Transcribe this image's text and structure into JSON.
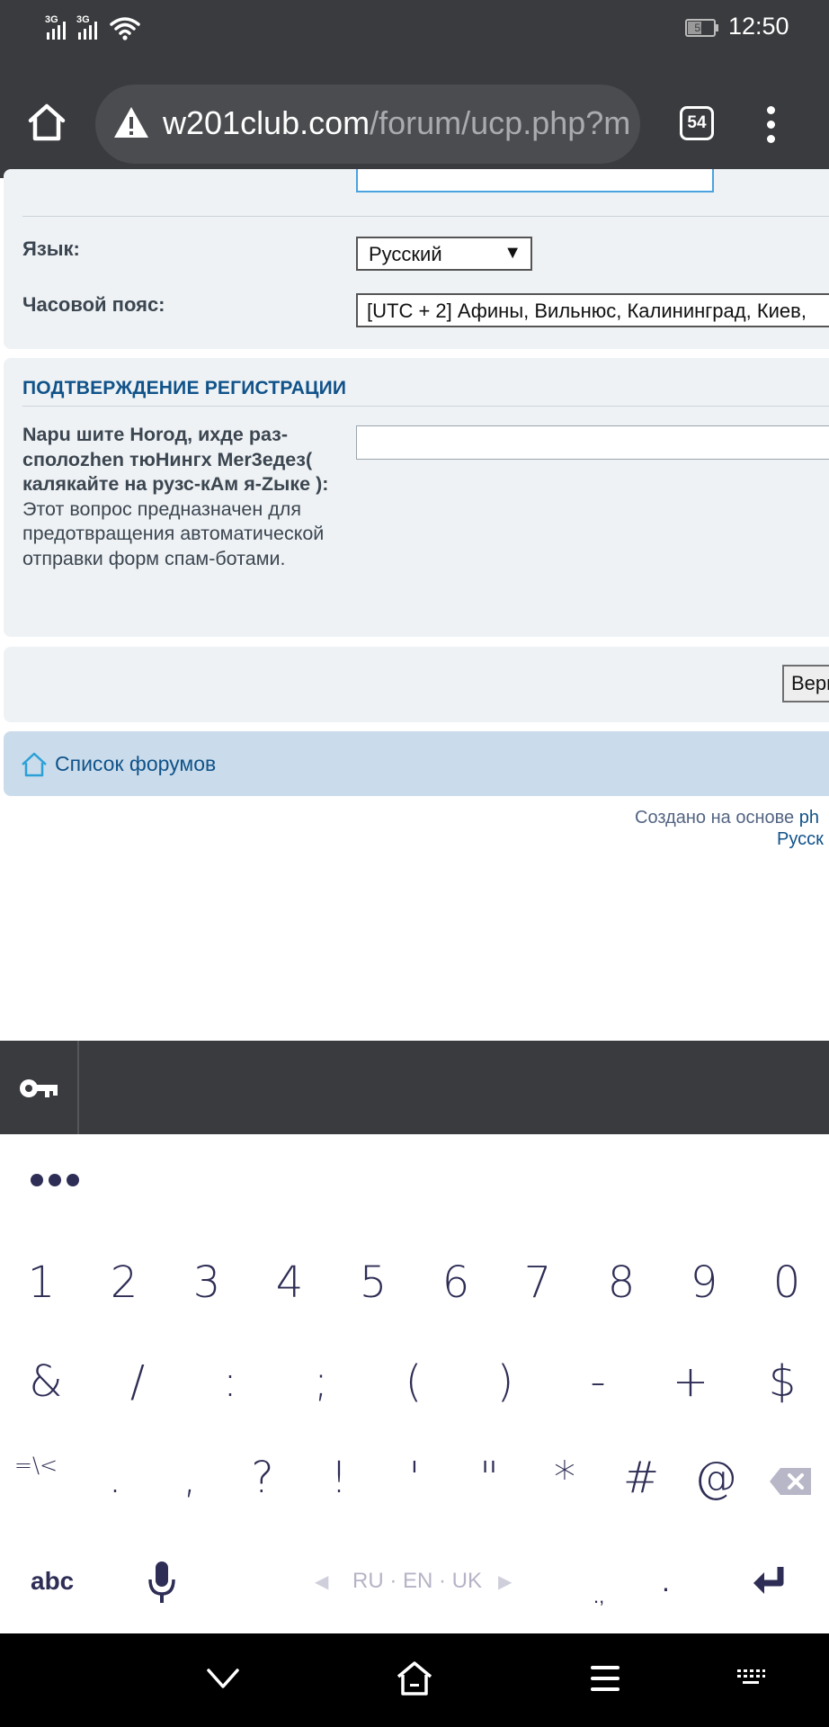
{
  "status_bar": {
    "signal1_label": "3G",
    "signal2_label": "3G",
    "battery": "55",
    "battery_level": 0.55,
    "time": "12:50"
  },
  "browser": {
    "url_domain": "w201club.com",
    "url_path": "/forum/ucp.php?m",
    "tab_count": "54"
  },
  "form": {
    "language_label": "Язык:",
    "language_value": "Русский",
    "timezone_label": "Часовой пояс:",
    "timezone_value": "[UTC + 2] Афины, Вильнюс, Калининград, Киев,"
  },
  "registration": {
    "title": "ПОДТВЕРЖДЕНИЕ РЕГИСТРАЦИИ",
    "question": "Napu шите Horoд, ихде раз-сполоzhen тюНингх Mer3eдез( калякайте на рузс-кАм я-Zыке ):",
    "explain": "Этот вопрос предназначен для предотвращения автоматической отправки форм спам-ботами.",
    "answer_value": ""
  },
  "submit": {
    "label": "Вери"
  },
  "nav": {
    "forum_list": "Список форумов"
  },
  "footer": {
    "created_prefix": "Создано на основе",
    "created_link": "ph",
    "lang_link": "Русск"
  },
  "keyboard": {
    "row_numbers": [
      "1",
      "2",
      "3",
      "4",
      "5",
      "6",
      "7",
      "8",
      "9",
      "0"
    ],
    "row_symbols1": [
      "&",
      "/",
      ":",
      ";",
      "(",
      ")",
      "-",
      "+",
      "$"
    ],
    "row_symbols2": [
      "=\\<",
      ".",
      ",",
      "?",
      "!",
      "'",
      "\"",
      "*",
      "#",
      "@"
    ],
    "abc": "abc",
    "languages": "RU · EN · UK",
    "comma_period": ".,",
    "period": "."
  },
  "colors": {
    "accent": "#105289",
    "panel": "#eef2f5",
    "keyboard_text": "#2e2d55",
    "bar_dark": "#3a3b3e"
  }
}
